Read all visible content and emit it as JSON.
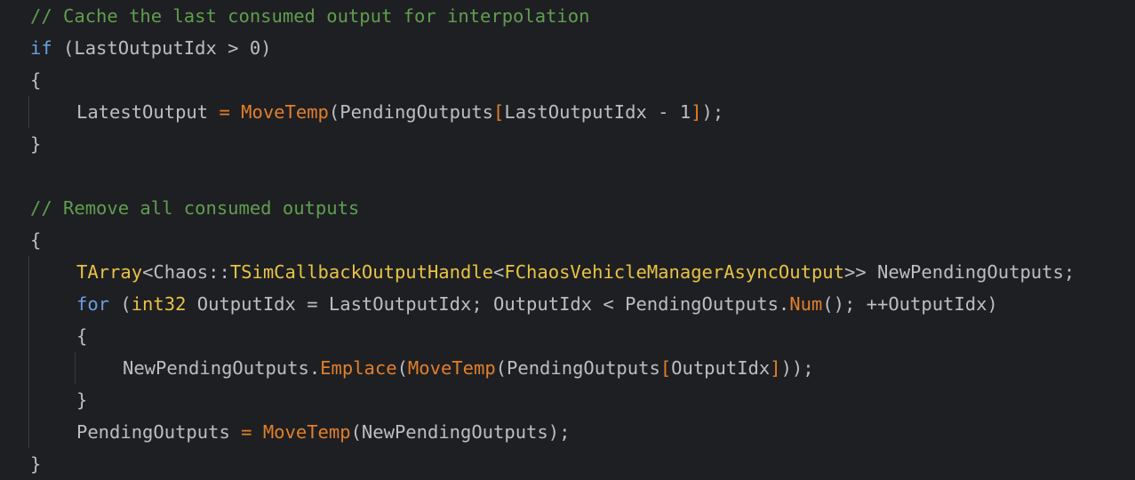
{
  "editor": {
    "lines": [
      {
        "indent": 0,
        "tokens": [
          {
            "t": "// Cache the last consumed output for interpolation",
            "c": "comment"
          }
        ]
      },
      {
        "indent": 0,
        "tokens": [
          {
            "t": "if",
            "c": "keyword"
          },
          {
            "t": " (LastOutputIdx > 0)",
            "c": "plain"
          }
        ]
      },
      {
        "indent": 0,
        "tokens": [
          {
            "t": "{",
            "c": "plain"
          }
        ]
      },
      {
        "indent": 1,
        "tokens": [
          {
            "t": "LatestOutput ",
            "c": "plain"
          },
          {
            "t": "=",
            "c": "func"
          },
          {
            "t": " ",
            "c": "plain"
          },
          {
            "t": "MoveTemp",
            "c": "func"
          },
          {
            "t": "(PendingOutputs",
            "c": "plain"
          },
          {
            "t": "[",
            "c": "func"
          },
          {
            "t": "LastOutputIdx - 1",
            "c": "plain"
          },
          {
            "t": "]",
            "c": "func"
          },
          {
            "t": ");",
            "c": "plain"
          }
        ]
      },
      {
        "indent": 0,
        "tokens": [
          {
            "t": "}",
            "c": "plain"
          }
        ]
      },
      {
        "indent": 0,
        "tokens": []
      },
      {
        "indent": 0,
        "tokens": [
          {
            "t": "// Remove all consumed outputs",
            "c": "comment"
          }
        ]
      },
      {
        "indent": 0,
        "tokens": [
          {
            "t": "{",
            "c": "plain"
          }
        ]
      },
      {
        "indent": 1,
        "tokens": [
          {
            "t": "TArray",
            "c": "type"
          },
          {
            "t": "<",
            "c": "plain"
          },
          {
            "t": "Chaos",
            "c": "plain"
          },
          {
            "t": "::",
            "c": "plain"
          },
          {
            "t": "TSimCallbackOutputHandle",
            "c": "type"
          },
          {
            "t": "<",
            "c": "plain"
          },
          {
            "t": "FChaosVehicleManagerAsyncOutput",
            "c": "type"
          },
          {
            "t": ">> NewPendingOutputs;",
            "c": "plain"
          }
        ]
      },
      {
        "indent": 1,
        "tokens": [
          {
            "t": "for",
            "c": "keyword"
          },
          {
            "t": " (",
            "c": "plain"
          },
          {
            "t": "int32",
            "c": "type"
          },
          {
            "t": " OutputIdx = LastOutputIdx; OutputIdx < PendingOutputs.",
            "c": "plain"
          },
          {
            "t": "Num",
            "c": "func"
          },
          {
            "t": "(); ++OutputIdx)",
            "c": "plain"
          }
        ]
      },
      {
        "indent": 1,
        "tokens": [
          {
            "t": "{",
            "c": "plain"
          }
        ]
      },
      {
        "indent": 2,
        "tokens": [
          {
            "t": "NewPendingOutputs.",
            "c": "plain"
          },
          {
            "t": "Emplace",
            "c": "func"
          },
          {
            "t": "(",
            "c": "plain"
          },
          {
            "t": "MoveTemp",
            "c": "func"
          },
          {
            "t": "(PendingOutputs",
            "c": "plain"
          },
          {
            "t": "[",
            "c": "func"
          },
          {
            "t": "OutputIdx",
            "c": "plain"
          },
          {
            "t": "]",
            "c": "func"
          },
          {
            "t": "));",
            "c": "plain"
          }
        ]
      },
      {
        "indent": 1,
        "tokens": [
          {
            "t": "}",
            "c": "plain"
          }
        ]
      },
      {
        "indent": 1,
        "tokens": [
          {
            "t": "PendingOutputs ",
            "c": "plain"
          },
          {
            "t": "=",
            "c": "func"
          },
          {
            "t": " ",
            "c": "plain"
          },
          {
            "t": "MoveTemp",
            "c": "func"
          },
          {
            "t": "(NewPendingOutputs);",
            "c": "plain"
          }
        ]
      },
      {
        "indent": 0,
        "tokens": [
          {
            "t": "}",
            "c": "plain"
          }
        ]
      }
    ]
  }
}
